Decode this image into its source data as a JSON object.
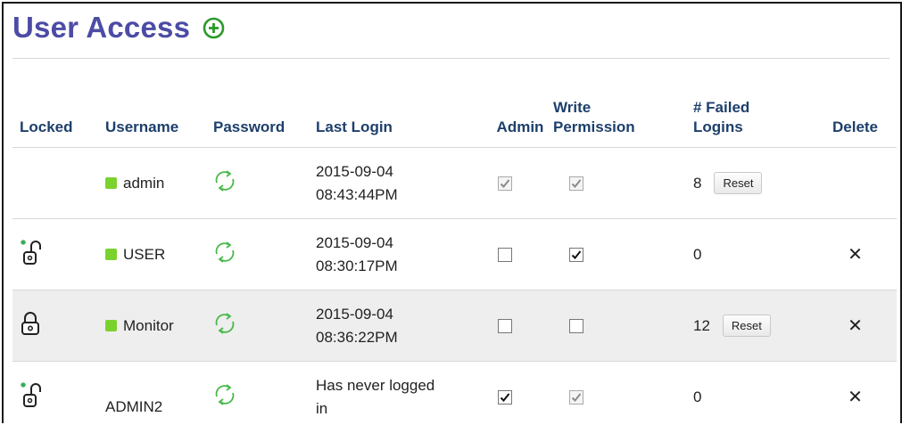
{
  "page": {
    "title": "User Access",
    "add_icon": "add-circle-icon"
  },
  "table": {
    "headers": {
      "locked": "Locked",
      "username": "Username",
      "password": "Password",
      "last_login": "Last Login",
      "admin": "Admin",
      "write_1": "Write",
      "write_2": "Permission",
      "failed_1": "# Failed",
      "failed_2": "Logins",
      "delete": "Delete"
    },
    "rows": [
      {
        "locked": "none",
        "username": "admin",
        "active": true,
        "login_1": "2015-09-04",
        "login_2": "08:43:44PM",
        "admin": true,
        "admin_disabled": true,
        "write": true,
        "write_disabled": true,
        "failed": "8",
        "show_reset": true,
        "reset_label": "Reset",
        "delete": ""
      },
      {
        "locked": "unlocked",
        "username": "USER",
        "active": true,
        "login_1": "2015-09-04",
        "login_2": "08:30:17PM",
        "admin": false,
        "admin_disabled": false,
        "write": true,
        "write_disabled": false,
        "failed": "0",
        "show_reset": false,
        "delete": "✕"
      },
      {
        "locked": "locked",
        "username": "Monitor",
        "active": true,
        "login_1": "2015-09-04",
        "login_2": "08:36:22PM",
        "admin": false,
        "admin_disabled": false,
        "write": false,
        "write_disabled": false,
        "failed": "12",
        "show_reset": true,
        "reset_label": "Reset",
        "delete": "✕"
      },
      {
        "locked": "unlocked",
        "username": "ADMIN2",
        "active": false,
        "login_1": "Has never logged",
        "login_2": "in",
        "admin": true,
        "admin_disabled": false,
        "write": true,
        "write_disabled": true,
        "failed": "0",
        "show_reset": false,
        "delete": "✕"
      }
    ]
  },
  "icons": {
    "password": "refresh-password-icon",
    "lock_open": "unlocked-padlock-icon",
    "lock_closed": "locked-padlock-icon",
    "delete": "delete-x-icon"
  },
  "colors": {
    "title": "#4c4ca6",
    "header_text": "#1d3f6b",
    "active_dot": "#7bd22e",
    "refresh_icon": "#4ab84a",
    "add_icon": "#2a9a2a",
    "row_highlight": "#eeeeee"
  }
}
